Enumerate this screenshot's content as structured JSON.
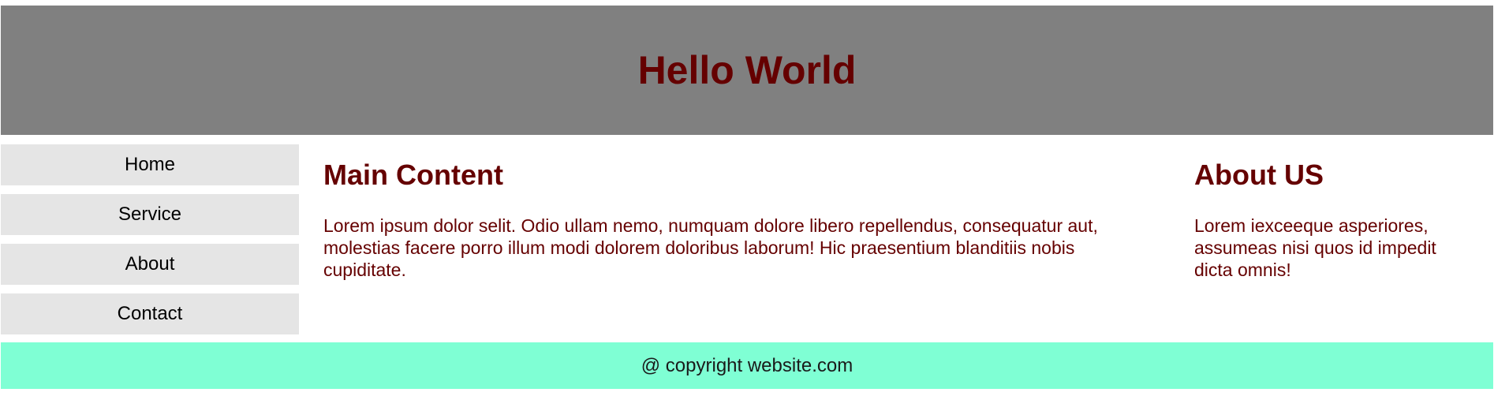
{
  "header": {
    "title": "Hello World"
  },
  "nav": {
    "items": [
      {
        "label": "Home"
      },
      {
        "label": "Service"
      },
      {
        "label": "About"
      },
      {
        "label": "Contact"
      }
    ]
  },
  "main": {
    "heading": "Main Content",
    "text": "Lorem ipsum dolor selit. Odio ullam nemo, numquam dolore libero repellendus, consequatur aut, molestias facere porro illum modi dolorem doloribus laborum! Hic praesentium blanditiis nobis cupiditate."
  },
  "aside": {
    "heading": "About US",
    "text": "Lorem iexceeque asperiores, assumeas nisi quos id impedit dicta omnis!"
  },
  "footer": {
    "text": "@ copyright website.com"
  },
  "colors": {
    "header_bg": "#808080",
    "heading_text": "#650000",
    "nav_bg": "#e5e5e5",
    "footer_bg": "#7fffd4"
  }
}
